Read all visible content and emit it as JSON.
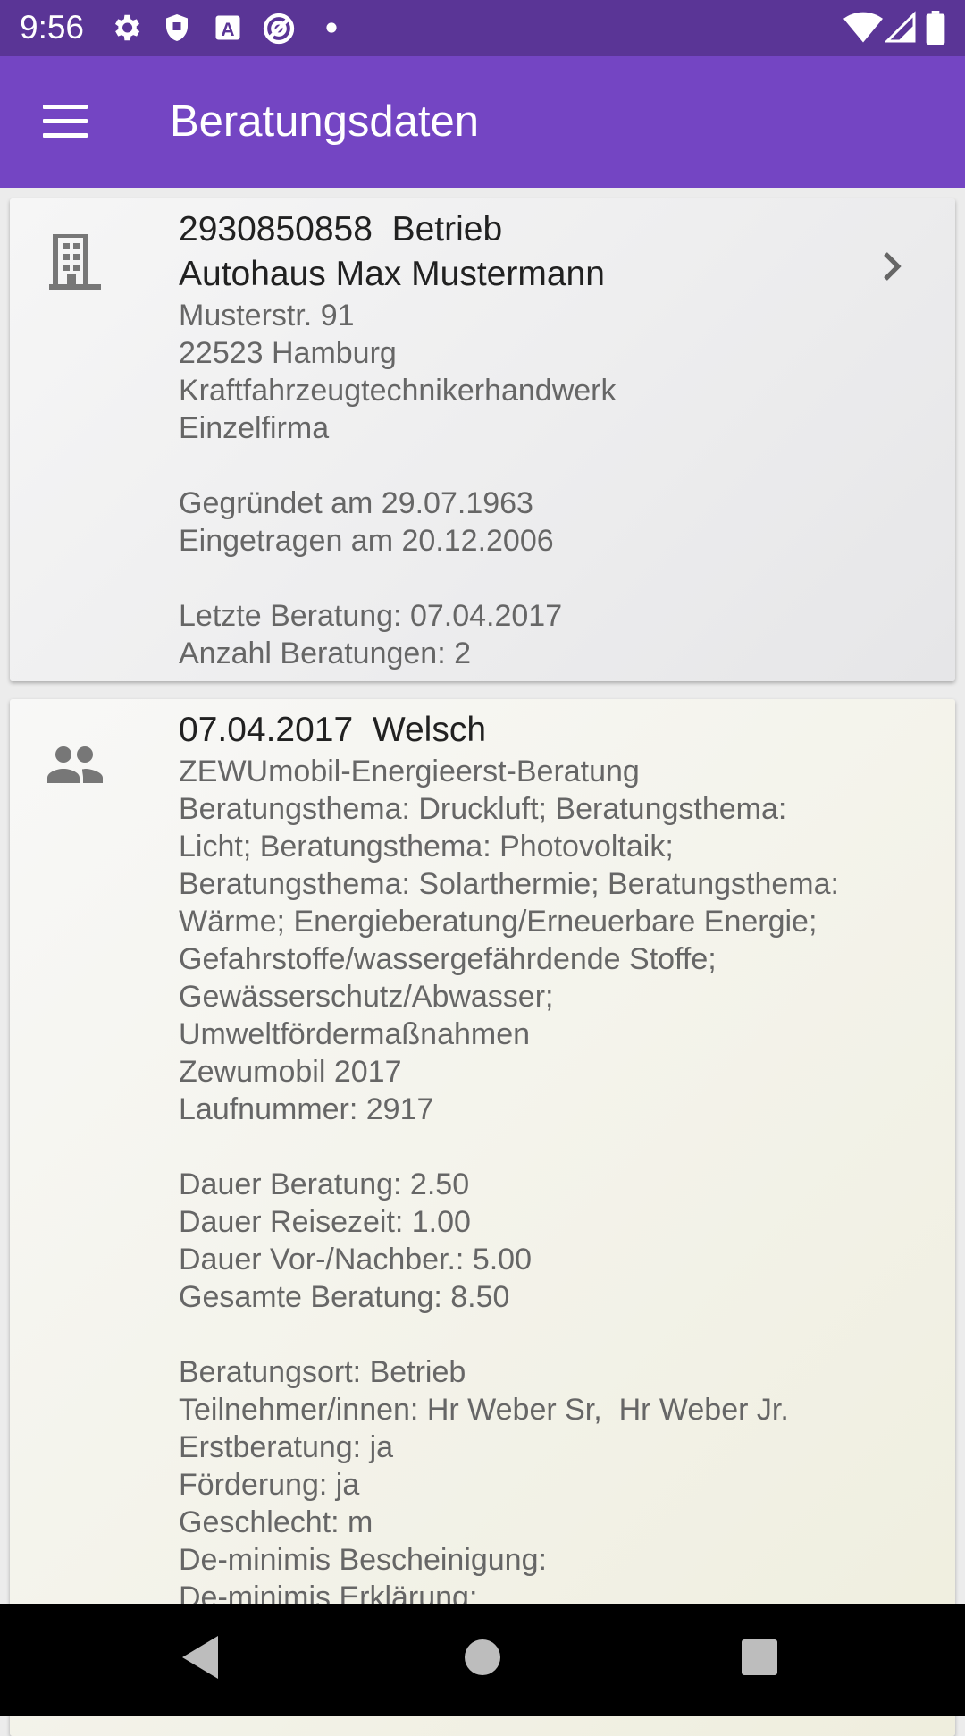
{
  "status_bar": {
    "time": "9:56",
    "left_icons": [
      "gear-icon",
      "shield-icon",
      "a-badge-icon",
      "sync-icon",
      "dot-icon"
    ],
    "right_icons": [
      "wifi-icon",
      "signal-icon",
      "battery-icon"
    ]
  },
  "app_bar": {
    "title": "Beratungsdaten",
    "menu_icon": "hamburger-menu-icon",
    "color": "#7445c3",
    "status_color": "#5a3596"
  },
  "company_card": {
    "icon": "building-icon",
    "header_line1": "2930850858  Betrieb",
    "header_line2": "Autohaus Max Mustermann",
    "street": "Musterstr. 91",
    "city": "22523 Hamburg",
    "trade": "Kraftfahrzeugtechnikerhandwerk",
    "legal_form": "Einzelfirma",
    "founded": "Gegründet am 29.07.1963",
    "registered": "Eingetragen am 20.12.2006",
    "last_consultation": "Letzte Beratung: 07.04.2017",
    "consultation_count": "Anzahl Beratungen: 2"
  },
  "consultation_card": {
    "icon": "people-icon",
    "header": "07.04.2017  Welsch",
    "topic_lines": [
      "ZEWUmobil-Energieerst-Beratung",
      "Beratungsthema: Druckluft; Beratungsthema:",
      "Licht; Beratungsthema: Photovoltaik;",
      "Beratungsthema: Solarthermie; Beratungsthema:",
      "Wärme; Energieberatung/Erneuerbare Energie;",
      "Gefahrstoffe/wassergefährdende Stoffe;",
      "Gewässerschutz/Abwasser;",
      "Umweltfördermaßnahmen",
      "Zewumobil 2017",
      "Laufnummer: 2917"
    ],
    "duration_lines": [
      "Dauer Beratung: 2.50",
      "Dauer Reisezeit: 1.00",
      "Dauer Vor-/Nachber.: 5.00",
      "Gesamte Beratung: 8.50"
    ],
    "detail_lines": [
      "Beratungsort: Betrieb",
      "Teilnehmer/innen: Hr Weber Sr,  Hr Weber Jr.",
      "Erstberatung: ja",
      "Förderung: ja",
      "Geschlecht: m",
      "De-minimis Bescheinigung:",
      "De-minimis Erklärung:"
    ]
  },
  "nav_bar": {
    "buttons": [
      "back-icon",
      "home-icon",
      "recents-icon"
    ]
  }
}
